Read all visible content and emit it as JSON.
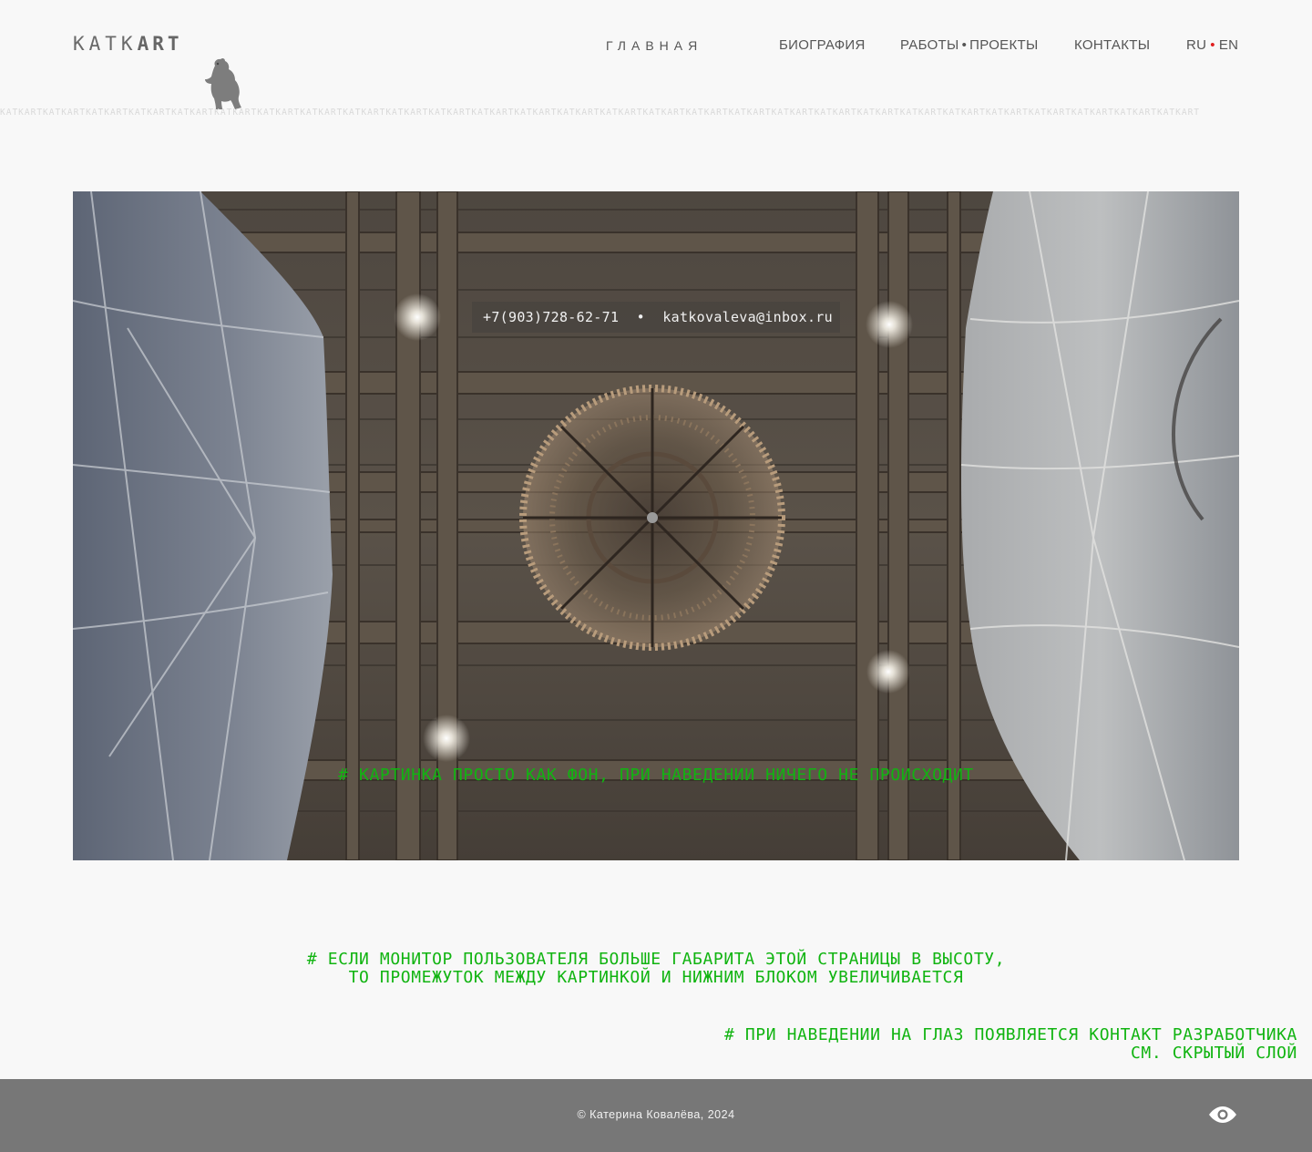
{
  "header": {
    "logo_light": "KATK",
    "logo_bold": "ART",
    "ticker": "KATKARTKATKARTKATKARTKATKARTKATKARTKATKARTKATKARTKATKARTKATKARTKATKARTKATKARTKATKARTKATKARTKATKARTKATKARTKATKARTKATKARTKATKARTKATKARTKATKARTKATKARTKATKARTKATKARTKATKARTKATKARTKATKARTKATKARTKATKART",
    "nav": {
      "home": "ГЛАВНАЯ",
      "biography": "БИОГРАФИЯ",
      "works": "РАБОТЫ",
      "works_sep": "•",
      "projects": "ПРОЕКТЫ",
      "contacts": "КОНТАКТЫ"
    },
    "lang": {
      "ru": "RU",
      "sep": "•",
      "en": "EN"
    }
  },
  "hero": {
    "phone": "+7(903)728-62-71",
    "contact_sep": "•",
    "email": "katkovaleva@inbox.ru",
    "note": "# картинка просто как фон, при наведении ничего не происходит"
  },
  "notes": {
    "mid_line1": "# если монитор пользователя больше габарита этой страницы в высоту,",
    "mid_line2": "то промежуток между картинкой и нижним блоком увеличивается",
    "right_line1": "# при наведении на глаз появляется контакт разработчика",
    "right_line2": "см. скрытый слой"
  },
  "footer": {
    "copyright": "© Катерина Ковалёва, 2024"
  },
  "icons": {
    "bear": "bear-icon",
    "eye": "eye-icon"
  },
  "colors": {
    "accent_red": "#e02020",
    "note_green": "#11b411",
    "footer_bg": "#777777"
  }
}
